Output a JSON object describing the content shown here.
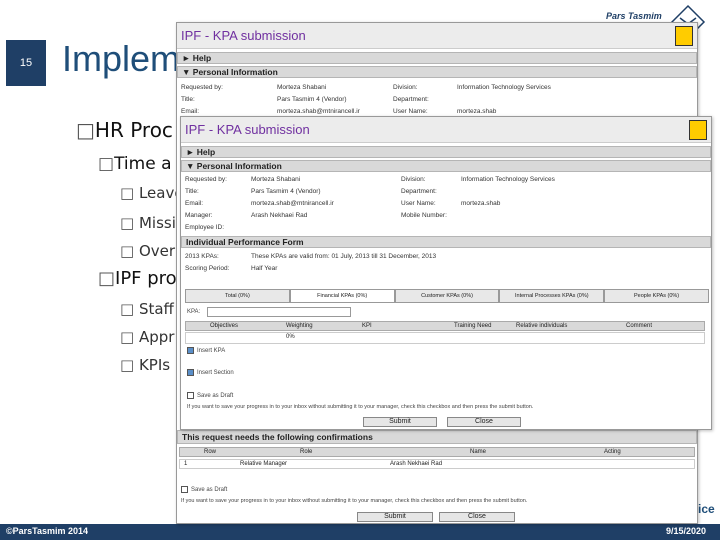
{
  "slide": {
    "number": "15",
    "title": "Impleme",
    "logo_text": "Pars Tasmim",
    "footer_left": "©ParsTasmim 2014",
    "footer_right": "9/15/2020",
    "corner_text": "ice"
  },
  "bullets": {
    "l1_hr": "HR Proc",
    "l2_time": "Time a",
    "l3_leave": "Leave",
    "l3_mission": "Missi",
    "l3_over": "Over",
    "l1_ipf": "IPF pro",
    "l2_staff": "Staff",
    "l2_appr": "Appr",
    "l2_kpis": "KPIs"
  },
  "window_back": {
    "title": "IPF - KPA submission",
    "help": "Help",
    "personal_info": "Personal Information",
    "labels": {
      "requested_by": "Requested by:",
      "title": "Title:",
      "email": "Email:",
      "division": "Division:",
      "department": "Department:",
      "user_name": "User Name:"
    },
    "values": {
      "requested_by": "Morteza Shabani",
      "title": "Pars Tasmim 4 (Vendor)",
      "email": "morteza.shab@mtnirancell.ir",
      "division": "Information Technology Services",
      "user_name": "morteza.shab"
    },
    "confirm_header": "This request needs the following confirmations",
    "confirm_cols": [
      "Row",
      "Role",
      "Name",
      "Acting"
    ],
    "confirm_row": [
      "1",
      "Relative Manager",
      "Arash Nekhaei Rad",
      ""
    ],
    "save_draft": "Save as Draft",
    "save_note": "If you want to save your progress in to your inbox without submitting it to your manager, check this checkbox and then press the submit button.",
    "submit": "Submit",
    "close": "Close"
  },
  "window_front": {
    "title": "IPF - KPA submission",
    "help": "Help",
    "personal_info": "Personal Information",
    "labels": {
      "requested_by": "Requested by:",
      "title": "Title:",
      "email": "Email:",
      "manager": "Manager:",
      "employee_id": "Employee ID:",
      "division": "Division:",
      "department": "Department:",
      "user_name": "User Name:",
      "mobile": "Mobile Number:"
    },
    "values": {
      "requested_by": "Morteza Shabani",
      "title": "Pars Tasmim 4 (Vendor)",
      "email": "morteza.shab@mtnirancell.ir",
      "manager": "Arash Nekhaei Rad",
      "division": "Information Technology Services",
      "user_name": "morteza.shab"
    },
    "ipf_header": "Individual Performance Form",
    "kpa_label": "2013 KPAs:",
    "kpa_text": "These KPAs are valid from: 01 July, 2013 till 31 December, 2013",
    "scoring_label": "Scoring Period:",
    "scoring_value": "Half Year",
    "tabs": [
      "Total (0%)",
      "Financial KPAs (0%)",
      "Customer KPAs (0%)",
      "Internal Processes KPAs (0%)",
      "People KPAs (0%)"
    ],
    "kpa_field_label": "KPA:",
    "grid_cols": [
      "Objectives",
      "Weighting",
      "KPI",
      "Training Need",
      "Relative individuals",
      "Comment"
    ],
    "weight_placeholder": "0%",
    "insert_kpa": "Insert KPA",
    "insert_section": "Insert Section",
    "save_draft": "Save as Draft",
    "save_note": "If you want to save your progress in to your inbox without submitting it to your manager, check this checkbox and then press the submit button.",
    "submit": "Submit",
    "close": "Close"
  },
  "colors": {
    "brand_navy": "#1f3f66",
    "title_blue": "#1f4e79",
    "window_title_purple": "#7030a0"
  }
}
